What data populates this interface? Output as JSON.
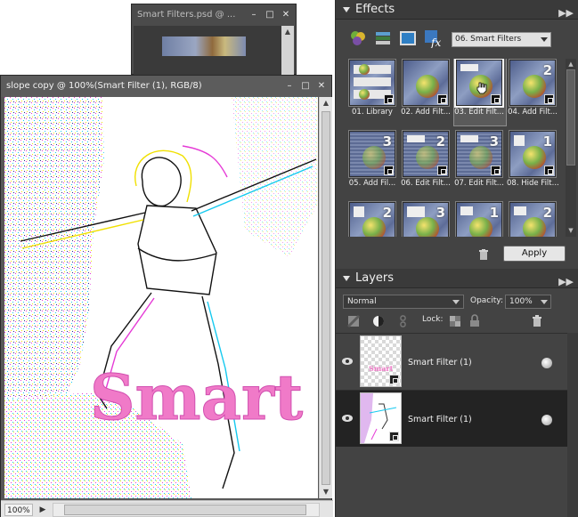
{
  "back_window": {
    "title": "Smart Filters.psd @ ..."
  },
  "main_window": {
    "title": "slope copy @ 100%(Smart Filter (1), RGB/8)",
    "zoom": "100%",
    "canvas_text": "Smart"
  },
  "window_buttons": {
    "minimize": "–",
    "maximize": "□",
    "close": "✕"
  },
  "effects_panel": {
    "title": "Effects",
    "category": "06. Smart Filters",
    "apply_label": "Apply",
    "items": [
      {
        "label": "01. Library",
        "number": ""
      },
      {
        "label": "02. Add Filt...",
        "number": ""
      },
      {
        "label": "03. Edit Filt...",
        "number": ""
      },
      {
        "label": "04. Add Filt...",
        "number": "2"
      },
      {
        "label": "05. Add Fil...",
        "number": "3"
      },
      {
        "label": "06. Edit Filt...",
        "number": "2"
      },
      {
        "label": "07. Edit Filt...",
        "number": "3"
      },
      {
        "label": "08. Hide Filt...",
        "number": "1"
      },
      {
        "label": "",
        "number": "2"
      },
      {
        "label": "",
        "number": "3"
      },
      {
        "label": "",
        "number": "1"
      },
      {
        "label": "",
        "number": "2"
      }
    ]
  },
  "layers_panel": {
    "title": "Layers",
    "blend_mode": "Normal",
    "opacity_label": "Opacity:",
    "opacity_value": "100%",
    "lock_label": "Lock:",
    "layers": [
      {
        "name": "Smart Filter (1)",
        "selected": false
      },
      {
        "name": "Smart Filter (1)",
        "selected": true
      }
    ]
  },
  "colors": {
    "panel_bg": "#434343",
    "panel_title_bg": "#3a3a3a",
    "smart_text": "#f07ac8",
    "selected_layer": "#232323"
  }
}
